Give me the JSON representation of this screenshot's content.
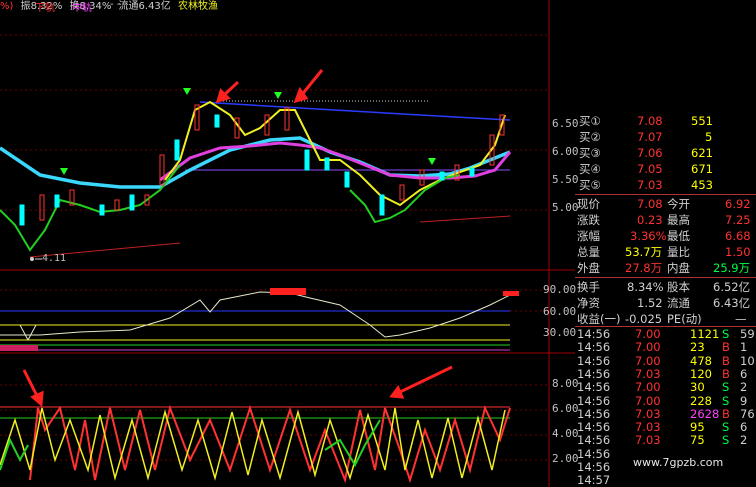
{
  "header": {
    "left_fragment": "%)",
    "hand_ratio_1": "振8.32%",
    "hand_ratio_2": "换8.34%",
    "circulation": "流通6.43亿",
    "sector": "农林牧渔",
    "lower_track": "下轨",
    "middle_track": "中轨",
    "track_tail": "- - -"
  },
  "main_axis": {
    "labels": [
      "6.50",
      "6.00",
      "5.50",
      "5.00"
    ]
  },
  "low_marker": "4.11",
  "indicator_axis": {
    "labels": [
      "90.00",
      "60.00",
      "30.00"
    ]
  },
  "lower_axis": {
    "labels": [
      "8.00",
      "6.00",
      "4.00",
      "2.00"
    ]
  },
  "order_book": [
    {
      "label": "买①",
      "price": "7.08",
      "volume": "551"
    },
    {
      "label": "买②",
      "price": "7.07",
      "volume": "5"
    },
    {
      "label": "买③",
      "price": "7.06",
      "volume": "621"
    },
    {
      "label": "买④",
      "price": "7.05",
      "volume": "671"
    },
    {
      "label": "买⑤",
      "price": "7.03",
      "volume": "453"
    }
  ],
  "quote_rows": [
    {
      "l1": "现价",
      "v1": "7.08",
      "l2": "今开",
      "v2": "6.92"
    },
    {
      "l1": "涨跌",
      "v1": "0.23",
      "l2": "最高",
      "v2": "7.25"
    },
    {
      "l1": "涨幅",
      "v1": "3.36%",
      "l2": "最低",
      "v2": "6.68"
    },
    {
      "l1": "总量",
      "v1": "53.7万",
      "l2": "量比",
      "v2": "1.50"
    },
    {
      "l1": "外盘",
      "v1": "27.8万",
      "l2": "内盘",
      "v2": "25.9万"
    }
  ],
  "stat_rows": [
    {
      "l1": "换手",
      "v1": "8.34%",
      "l2": "股本",
      "v2": "6.52亿"
    },
    {
      "l1": "净资",
      "v1": "1.52",
      "l2": "流通",
      "v2": "6.43亿"
    },
    {
      "l1": "收益(一)",
      "v1": "-0.025",
      "l2": "PE(动)",
      "v2": "—"
    }
  ],
  "trades": [
    {
      "time": "14:56",
      "price": "7.00",
      "vol": "1121",
      "side": "S",
      "n": "59"
    },
    {
      "time": "14:56",
      "price": "7.00",
      "vol": "23",
      "side": "B",
      "n": "1"
    },
    {
      "time": "14:56",
      "price": "7.00",
      "vol": "478",
      "side": "B",
      "n": "10"
    },
    {
      "time": "14:56",
      "price": "7.03",
      "vol": "120",
      "side": "B",
      "n": "6"
    },
    {
      "time": "14:56",
      "price": "7.00",
      "vol": "30",
      "side": "S",
      "n": "2"
    },
    {
      "time": "14:56",
      "price": "7.00",
      "vol": "228",
      "side": "S",
      "n": "9"
    },
    {
      "time": "14:56",
      "price": "7.03",
      "vol": "2628",
      "side": "B",
      "n": "76"
    },
    {
      "time": "14:56",
      "price": "7.03",
      "vol": "95",
      "side": "S",
      "n": "6"
    },
    {
      "time": "14:56",
      "price": "7.03",
      "vol": "75",
      "side": "S",
      "n": "2"
    },
    {
      "time": "14:56",
      "price": "",
      "vol": "",
      "side": "",
      "n": ""
    },
    {
      "time": "14:56",
      "price": "",
      "vol": "",
      "side": "",
      "n": ""
    },
    {
      "time": "14:57",
      "price": "",
      "vol": "",
      "side": "",
      "n": ""
    }
  ],
  "watermark": "www.7gpzb.com",
  "colors": {
    "up": "#ff3232",
    "down": "#00ffff",
    "label": "#d0d0d0",
    "value_yellow": "#ffff00",
    "grid": "#8b0000"
  }
}
